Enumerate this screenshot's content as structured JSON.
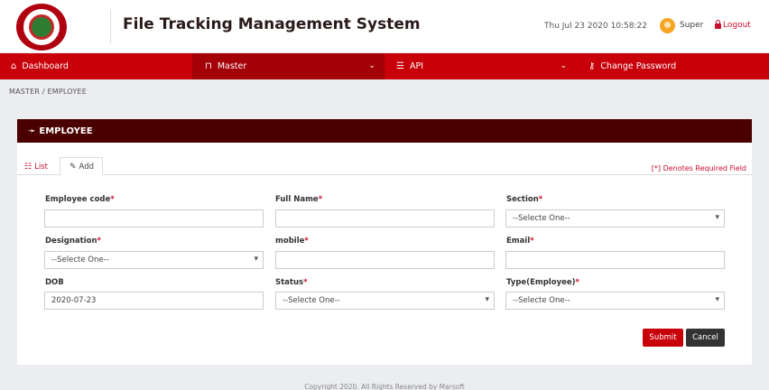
{
  "header": {
    "app_title": "File Tracking Management System",
    "datetime": "Thu Jul 23 2020 10:58:22",
    "user_name": "Super",
    "logout_label": "Logout"
  },
  "nav": {
    "items": [
      {
        "label": "Dashboard",
        "icon": "home-icon"
      },
      {
        "label": "Master",
        "icon": "lock-icon",
        "active": true
      },
      {
        "label": "API",
        "icon": "server-icon"
      },
      {
        "label": "Change Password",
        "icon": "key-icon"
      }
    ]
  },
  "breadcrumb": "MASTER  /  EMPLOYEE",
  "card": {
    "title": "EMPLOYEE",
    "tabs": {
      "list": "List",
      "add": "Add"
    },
    "required_note": "[*] Denotes Required Field"
  },
  "form": {
    "employee_code": {
      "label": "Employee code",
      "value": ""
    },
    "full_name": {
      "label": "Full Name",
      "value": ""
    },
    "section": {
      "label": "Section",
      "value": "--Selecte One--"
    },
    "designation": {
      "label": "Designation",
      "value": "--Selecte One--"
    },
    "mobile": {
      "label": "mobile",
      "value": ""
    },
    "email": {
      "label": "Email",
      "value": ""
    },
    "dob": {
      "label": "DOB",
      "value": "2020-07-23"
    },
    "status": {
      "label": "Status",
      "value": "--Selecte One--"
    },
    "type": {
      "label": "Type(Employee)",
      "value": "--Selecte One--"
    },
    "required_mark": "*"
  },
  "buttons": {
    "submit": "Submit",
    "cancel": "Cancel"
  },
  "footer": "Copyright 2020. All Rights Reserved by Marsoft",
  "colors": {
    "primary_red": "#c8000a",
    "card_header": "#4b0000",
    "dark_button": "#333333"
  }
}
